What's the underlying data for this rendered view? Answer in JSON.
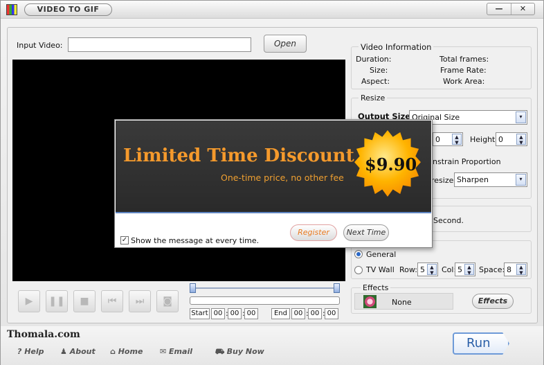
{
  "window": {
    "title": "VIDEO TO GIF",
    "minimize": "—",
    "close": "✕"
  },
  "input": {
    "label": "Input Video:",
    "value": "",
    "open_button": "Open"
  },
  "video_info": {
    "title": "Video Information",
    "duration": "Duration:",
    "size": "Size:",
    "aspect": "Aspect:",
    "total_frames": "Total frames:",
    "frame_rate": "Frame Rate:",
    "work_area": "Work Area:"
  },
  "resize": {
    "title": "Resize",
    "output_size_label": "Output Size:",
    "output_size_value": "Original Size",
    "width_value": "0",
    "height_label": "Height:",
    "height_value": "0",
    "constrain_label": "nstrain Proportion",
    "resize_label": "resize:",
    "resize_value": "Sharpen"
  },
  "delay": {
    "unit": "Second."
  },
  "layout": {
    "general_label": "General",
    "tvwall_label": "TV Wall",
    "row_label": "Row:",
    "row_value": "5",
    "col_label": "Col:",
    "col_value": "5",
    "space_label": "Space:",
    "space_value": "8",
    "selected": "General"
  },
  "effects": {
    "title": "Effects",
    "value": "None",
    "button": "Effects"
  },
  "player": {
    "start_label": "Start",
    "end_label": "End",
    "start_time": [
      "00",
      "00",
      "00"
    ],
    "end_time": [
      "00",
      "00",
      "00"
    ]
  },
  "footer": {
    "brand": "Thomala.com",
    "help": "Help",
    "about": "About",
    "home": "Home",
    "email": "Email",
    "buy_now": "Buy Now",
    "run": "Run"
  },
  "popup": {
    "headline": "Limited Time Discount",
    "subline": "One-time price, no other fee",
    "price": "$9.90",
    "checkbox_label": "Show the message at every time.",
    "checkbox_checked": true,
    "register_button": "Register",
    "next_button": "Next Time"
  },
  "colors": {
    "headline": "#f59a2c",
    "subline": "#f0a030",
    "accent_blue": "#2a6acb"
  }
}
